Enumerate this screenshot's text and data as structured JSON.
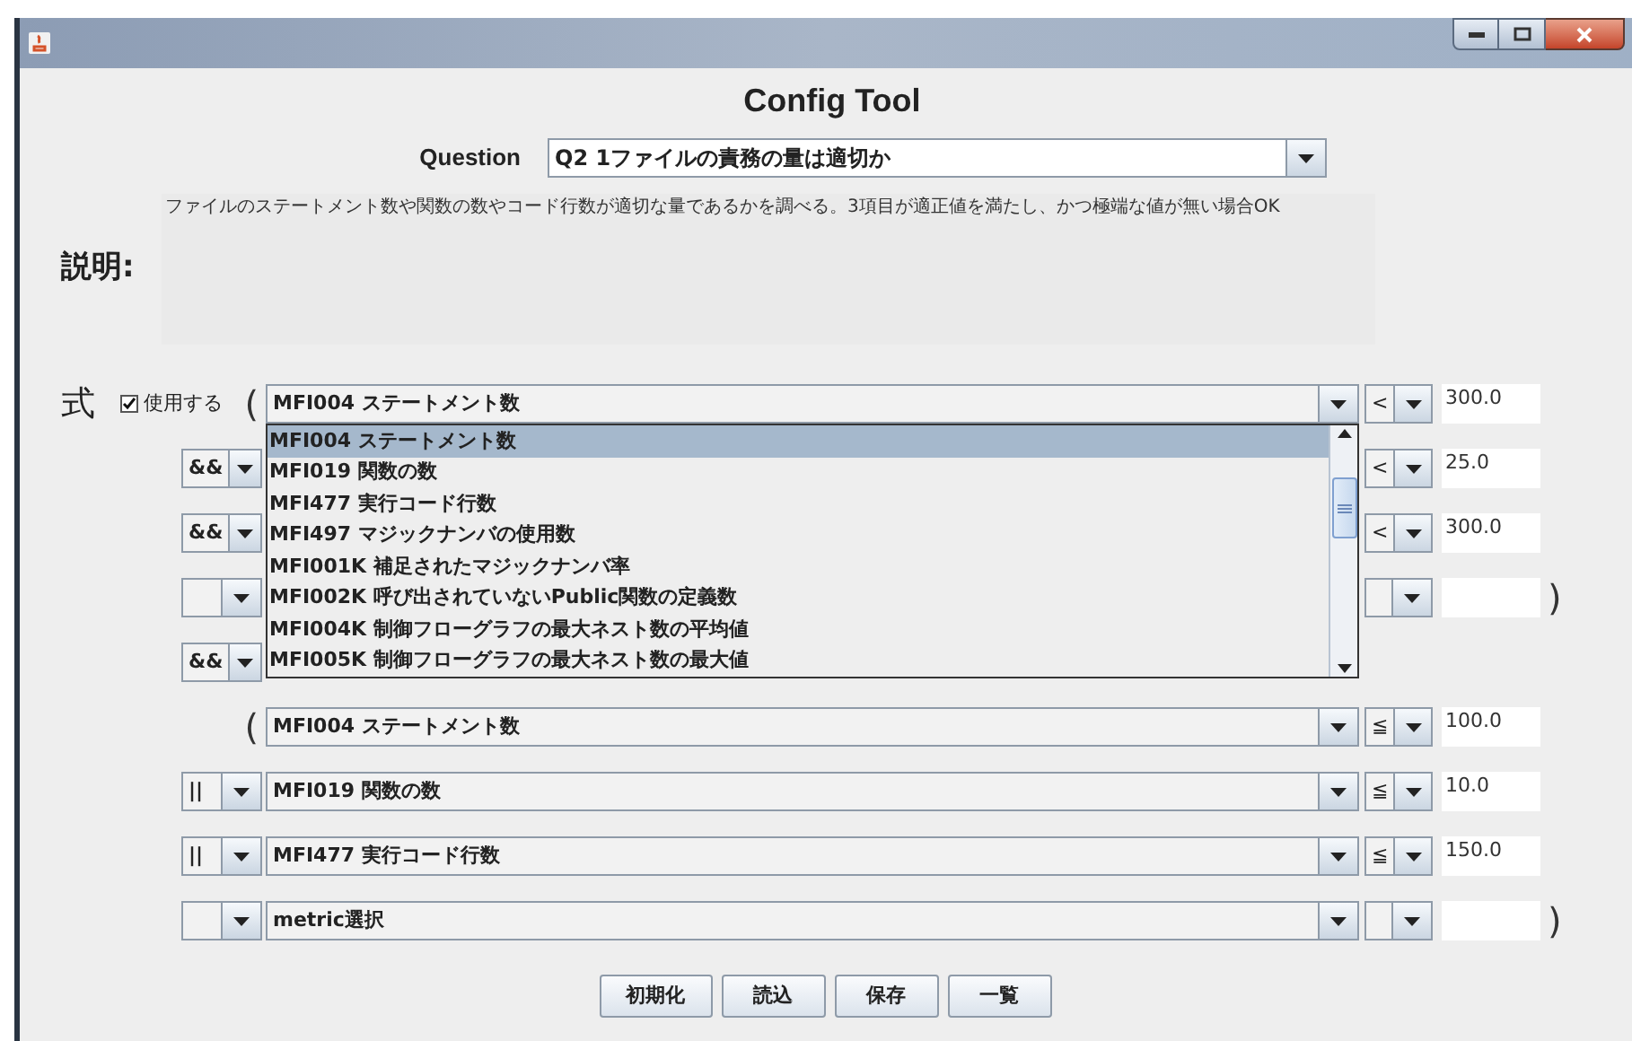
{
  "window": {
    "title": "Config Tool"
  },
  "question": {
    "label": "Question",
    "value": "Q2 1ファイルの責務の量は適切か"
  },
  "description": {
    "label": "説明:",
    "text": "ファイルのステートメント数や関数の数やコード行数が適切な量であるかを調べる。3項目が適正値を満たし、かつ極端な値が無い場合OK"
  },
  "expression": {
    "label": "式",
    "use_checkbox": {
      "label": "使用する",
      "checked": true
    },
    "rows": [
      {
        "open_paren": "(",
        "metric": "MFI004 ステートメント数",
        "operator": "<",
        "value": "300.0"
      },
      {
        "logic": "&&",
        "operator": "<",
        "value": "25.0"
      },
      {
        "logic": "&&",
        "operator": "<",
        "value": "300.0"
      },
      {
        "logic": "",
        "operator": "",
        "value": "",
        "close_paren": ")"
      },
      {
        "logic": "&&"
      },
      {
        "open_paren": "(",
        "metric": "MFI004 ステートメント数",
        "operator": "≦",
        "value": "100.0"
      },
      {
        "logic": "||",
        "metric": "MFI019 関数の数",
        "operator": "≦",
        "value": "10.0"
      },
      {
        "logic": "||",
        "metric": "MFI477 実行コード行数",
        "operator": "≦",
        "value": "150.0"
      },
      {
        "logic": "",
        "metric": "metric選択",
        "operator": "",
        "value": "",
        "close_paren": ")"
      }
    ]
  },
  "metric_dropdown": {
    "items": [
      {
        "label": "MFI004 ステートメント数",
        "selected": true
      },
      {
        "label": "MFI019 関数の数",
        "selected": false
      },
      {
        "label": "MFI477 実行コード行数",
        "selected": false
      },
      {
        "label": "MFI497 マジックナンバの使用数",
        "selected": false
      },
      {
        "label": "MFI001K 補足されたマジックナンバ率",
        "selected": false
      },
      {
        "label": "MFI002K 呼び出されていないPublic関数の定義数",
        "selected": false
      },
      {
        "label": "MFI004K 制御フローグラフの最大ネスト数の平均値",
        "selected": false
      },
      {
        "label": "MFI005K 制御フローグラフの最大ネスト数の最大値",
        "selected": false
      }
    ]
  },
  "buttons": [
    "初期化",
    "読込",
    "保存",
    "一覧"
  ]
}
